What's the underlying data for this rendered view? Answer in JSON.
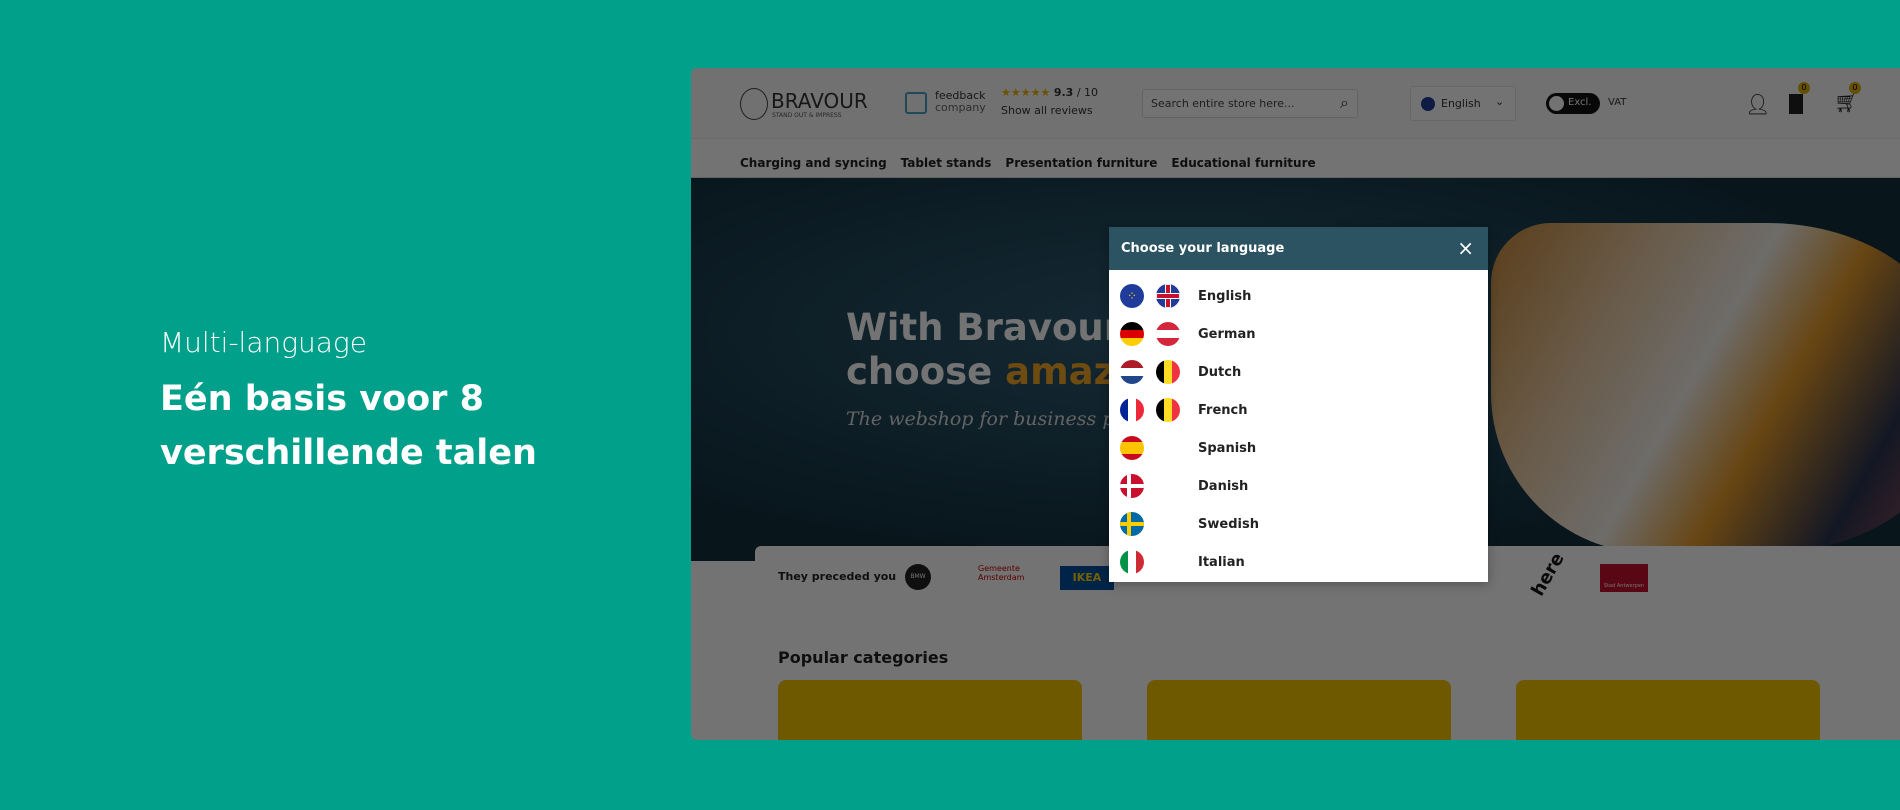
{
  "promo": {
    "lead": "Multi-language",
    "headline": "Eén basis voor 8 verschillende talen"
  },
  "header": {
    "logo": "BRAVOUR",
    "logo_tagline": "STAND OUT & IMPRESS",
    "feedback_line1": "feedback",
    "feedback_line2": "company",
    "rating": "9.3",
    "rating_scale": "/ 10",
    "reviews_link": "Show all reviews",
    "search_placeholder": "Search entire store here...",
    "language": "English",
    "vat_toggle": "Excl.",
    "vat_label": "VAT",
    "wishlist_count": "0",
    "cart_count": "0"
  },
  "nav": [
    "Charging and syncing",
    "Tablet stands",
    "Presentation furniture",
    "Educational furniture"
  ],
  "hero": {
    "line1": "With Bravour®,",
    "line2_a": "choose ",
    "line2_b": "amazement",
    "subtitle": "The webshop for business presentations",
    "accent": "#f5a623"
  },
  "clients": {
    "label": "They preceded you",
    "logos": [
      "BMW",
      "Gemeente Amsterdam",
      "IKEA",
      "here",
      "Stad Antwerpen"
    ]
  },
  "categories": {
    "title": "Popular categories"
  },
  "modal": {
    "title": "Choose your language",
    "close": "×",
    "languages": [
      {
        "label": "English",
        "flags": [
          "eu",
          "gb"
        ]
      },
      {
        "label": "German",
        "flags": [
          "de",
          "at"
        ]
      },
      {
        "label": "Dutch",
        "flags": [
          "nl",
          "be"
        ]
      },
      {
        "label": "French",
        "flags": [
          "fr",
          "be"
        ]
      },
      {
        "label": "Spanish",
        "flags": [
          "es"
        ]
      },
      {
        "label": "Danish",
        "flags": [
          "dk"
        ]
      },
      {
        "label": "Swedish",
        "flags": [
          "se"
        ]
      },
      {
        "label": "Italian",
        "flags": [
          "it"
        ]
      }
    ]
  },
  "colors": {
    "background": "#00a08a",
    "modal_header": "#2b5361",
    "card": "#f5c400"
  }
}
